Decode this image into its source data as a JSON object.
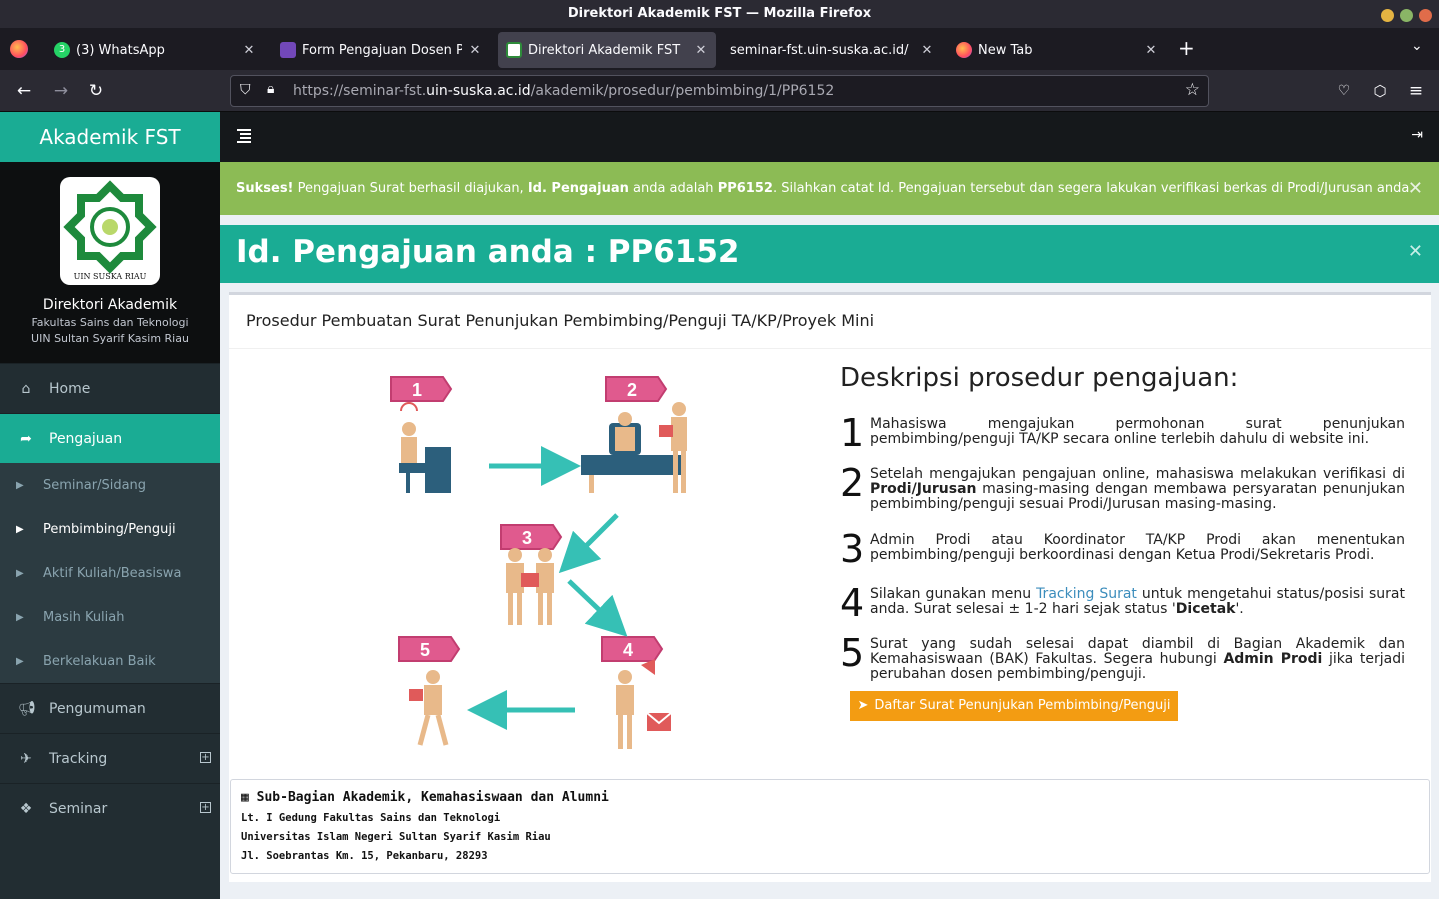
{
  "window": {
    "title": "Direktori Akademik FST — Mozilla Firefox"
  },
  "tabs": [
    {
      "label": "(3) WhatsApp",
      "active": false
    },
    {
      "label": "Form Pengajuan Dosen Pem",
      "active": false
    },
    {
      "label": "Direktori Akademik FST",
      "active": true
    },
    {
      "label": "seminar-fst.uin-suska.ac.id/",
      "active": false
    },
    {
      "label": "New Tab",
      "active": false
    }
  ],
  "urlbar": {
    "prefix": "https://seminar-fst.",
    "domain": "uin-suska.ac.id",
    "path": "/akademik/prosedur/pembimbing/1/PP6152"
  },
  "sidebar": {
    "brand": "Akademik FST",
    "logo_text": "UIN SUSKA RIAU",
    "profile_title": "Direktori Akademik",
    "profile_line1": "Fakultas Sains dan Teknologi",
    "profile_line2": "UIN Sultan Syarif Kasim Riau",
    "menu": [
      {
        "label": "Home",
        "icon": "home-icon"
      },
      {
        "label": "Pengajuan",
        "icon": "share-icon"
      }
    ],
    "submenu": [
      "Seminar/Sidang",
      "Pembimbing/Penguji",
      "Aktif Kuliah/Beasiswa",
      "Masih Kuliah",
      "Berkelakuan Baik"
    ],
    "menu2": [
      {
        "label": "Pengumuman",
        "icon": "bullhorn-icon"
      },
      {
        "label": "Tracking",
        "icon": "plane-icon"
      },
      {
        "label": "Seminar",
        "icon": "cubes-icon"
      }
    ]
  },
  "alert_success": {
    "strong": "Sukses!",
    "text1": " Pengajuan Surat berhasil diajukan, ",
    "strong2": "Id. Pengajuan",
    "text2": " anda adalah ",
    "strong3": "PP6152",
    "text3": ". Silahkan catat Id. Pengajuan tersebut dan segera lakukan verifikasi berkas di Prodi/Jurusan anda."
  },
  "id_banner": "Id. Pengajuan anda : PP6152",
  "box": {
    "title": "Prosedur Pembuatan Surat Penunjukan Pembimbing/Penguji TA/KP/Proyek Mini",
    "desc_title": "Deskripsi prosedur pengajuan:",
    "steps": [
      {
        "num": "1",
        "a": "Mahasiswa mengajukan permohonan surat penunjukan pembimbing/penguji TA/KP secara online terlebih dahulu di website ini."
      },
      {
        "num": "2",
        "a": "Setelah mengajukan pengajuan online, mahasiswa melakukan verifikasi di ",
        "b": "Prodi/Jurusan",
        "c": " masing-masing dengan membawa persyaratan penunjukan pembimbing/penguji sesuai Prodi/Jurusan masing-masing."
      },
      {
        "num": "3",
        "a": "Admin Prodi atau Koordinator TA/KP Prodi akan menentukan pembimbing/penguji berkoordinasi dengan Ketua Prodi/Sekretaris Prodi."
      },
      {
        "num": "4",
        "a": "Silakan gunakan menu ",
        "link": "Tracking Surat",
        "c": " untuk mengetahui status/posisi surat anda. Surat selesai ± 1-2 hari sejak status '",
        "b": "Dicetak",
        "d": "'."
      },
      {
        "num": "5",
        "a": "Surat yang sudah selesai dapat diambil di Bagian Akademik dan Kemahasiswaan (BAK) Fakultas. Segera hubungi ",
        "b": "Admin Prodi",
        "c": " jika terjadi perubahan dosen pembimbing/penguji."
      }
    ],
    "button": "Daftar Surat Penunjukan Pembimbing/Penguji",
    "illustration_badges": [
      "1",
      "2",
      "3",
      "4",
      "5"
    ]
  },
  "footer": {
    "title": "Sub-Bagian Akademik, Kemahasiswaan dan Alumni",
    "lines": [
      "Lt. I Gedung Fakultas Sains dan Teknologi",
      "Universitas Islam Negeri Sultan Syarif Kasim Riau",
      "Jl. Soebrantas Km. 15, Pekanbaru, 28293"
    ]
  },
  "colors": {
    "teal": "#1aac94",
    "green_alert": "#8cbb55",
    "orange": "#f39c12",
    "badge_pink": "#e05a8e",
    "arrow_teal": "#36c0b5"
  }
}
